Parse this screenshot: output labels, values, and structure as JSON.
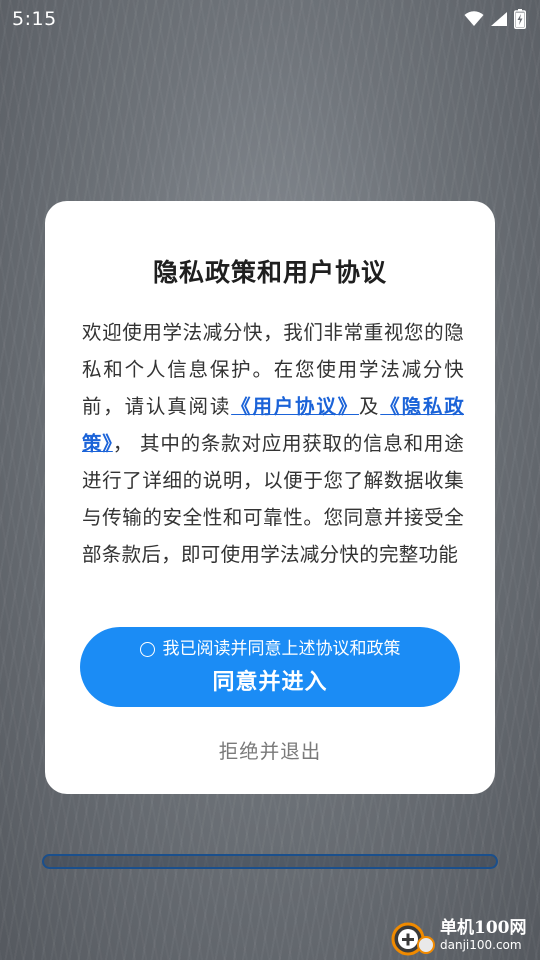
{
  "status_bar": {
    "time": "5:15"
  },
  "dialog": {
    "title": "隐私政策和用户协议",
    "body": {
      "intro": "欢迎使用学法减分快，我们非常重视您的隐私和个人信息保护。在您使用学法减分快前，请认真阅读",
      "user_agreement_link": "《用户协议》",
      "and": "及",
      "privacy_policy_link": "《隐私政策》",
      "rest": "， 其中的条款对应用获取的信息和用途进行了详细的说明，以便于您了解数据收集与传输的安全性和可靠性。您同意并接受全部条款后，即可使用学法减分快的完整功能"
    },
    "consent_checkbox_label": "我已阅读并同意上述协议和政策",
    "agree_button_label": "同意并进入",
    "reject_button_label": "拒绝并退出"
  },
  "watermark": {
    "name": "单机100网",
    "url": "danji100.com"
  },
  "colors": {
    "accent": "#1b8cf5",
    "link": "#1b63d8"
  }
}
